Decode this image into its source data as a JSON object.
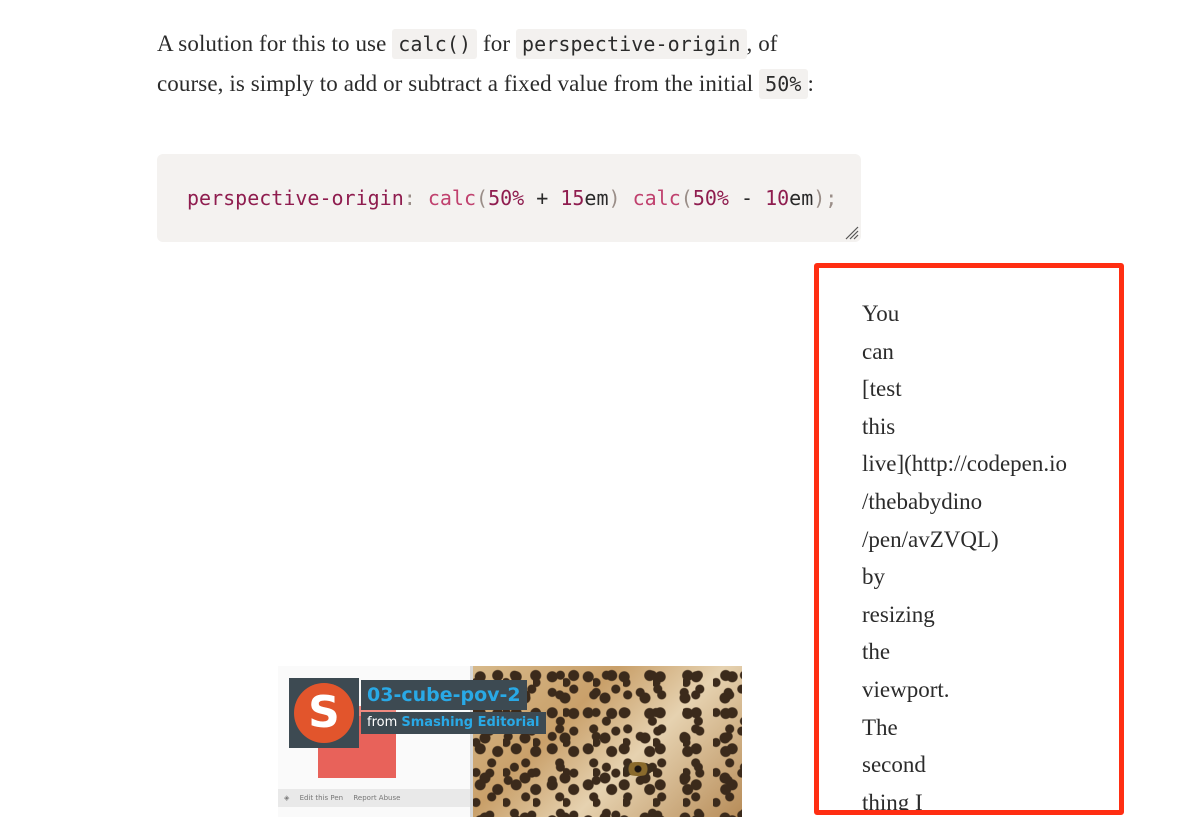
{
  "intro": {
    "part1": "A solution for this to use ",
    "code1": "calc()",
    "part2": " for ",
    "code2": "perspective-origin",
    "part3": ", of",
    "part4": "course, is simply to add or subtract a fixed value from the initial ",
    "code3": "50%",
    "part5": ":"
  },
  "code_block": {
    "property": "perspective-origin",
    "colon": ":",
    "fn1": "calc",
    "open1": "(",
    "num1": "50%",
    "op1": " + ",
    "num2": "15",
    "unit2": "em",
    "close1": ")",
    "fn2": "calc",
    "open2": "(",
    "num3": "50%",
    "op2": " - ",
    "num4": "10",
    "unit4": "em",
    "close2": ")",
    "semicolon": ";"
  },
  "embed": {
    "title": "03-cube-pov-2",
    "from_label": "from ",
    "author": "Smashing Editorial",
    "logo_letter": "S",
    "footer_edit": "Edit this Pen",
    "footer_report": "Report Abuse"
  },
  "narrow_column": {
    "words": [
      "You",
      "can",
      "[test",
      "this",
      "live](http://codepen.io",
      "/thebabydino",
      "/pen/avZVQL)",
      "by",
      "resizing",
      "the",
      "viewport.",
      "The",
      "second",
      "thing I"
    ]
  },
  "colors": {
    "highlight_border": "#ff2e12",
    "code_background": "#f4f2f0",
    "css_property": "#8f1d4f",
    "css_function": "#c0416e",
    "codepen_blue": "#29a9e6",
    "smashing_orange": "#e2552c"
  }
}
